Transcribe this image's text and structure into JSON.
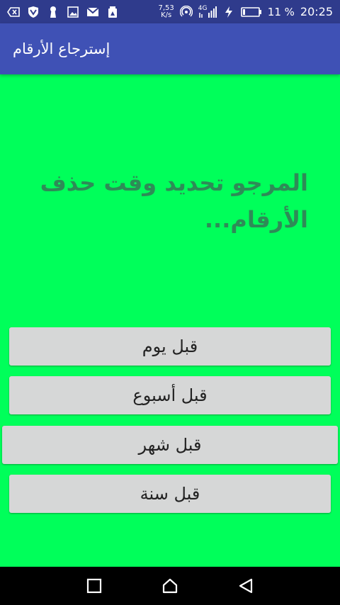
{
  "status_bar": {
    "icons": [
      "back-arrow-icon",
      "shield-icon",
      "keyhole-icon",
      "image-icon",
      "gmail-icon",
      "android-icon"
    ],
    "speed_value": "7,53",
    "speed_unit": "K/s",
    "network_type": "4G",
    "battery": "11 %",
    "time": "20:25"
  },
  "app_bar": {
    "title": "إسترجاع الأرقام"
  },
  "main": {
    "prompt": "المرجو تحديد وقت حذف الأرقام..."
  },
  "buttons": {
    "day": "قبل يوم",
    "week": "قبل أسبوع",
    "month": "قبل شهر",
    "year": "قبل سنة"
  },
  "nav_bar": {
    "icons": [
      "recents-icon",
      "home-icon",
      "back-icon"
    ]
  },
  "colors": {
    "status_bar": "#2f3b8c",
    "app_bar": "#3f51b5",
    "background": "#00ff5a",
    "prompt_text": "#2e8b57",
    "button_bg": "#d6d7d7"
  }
}
